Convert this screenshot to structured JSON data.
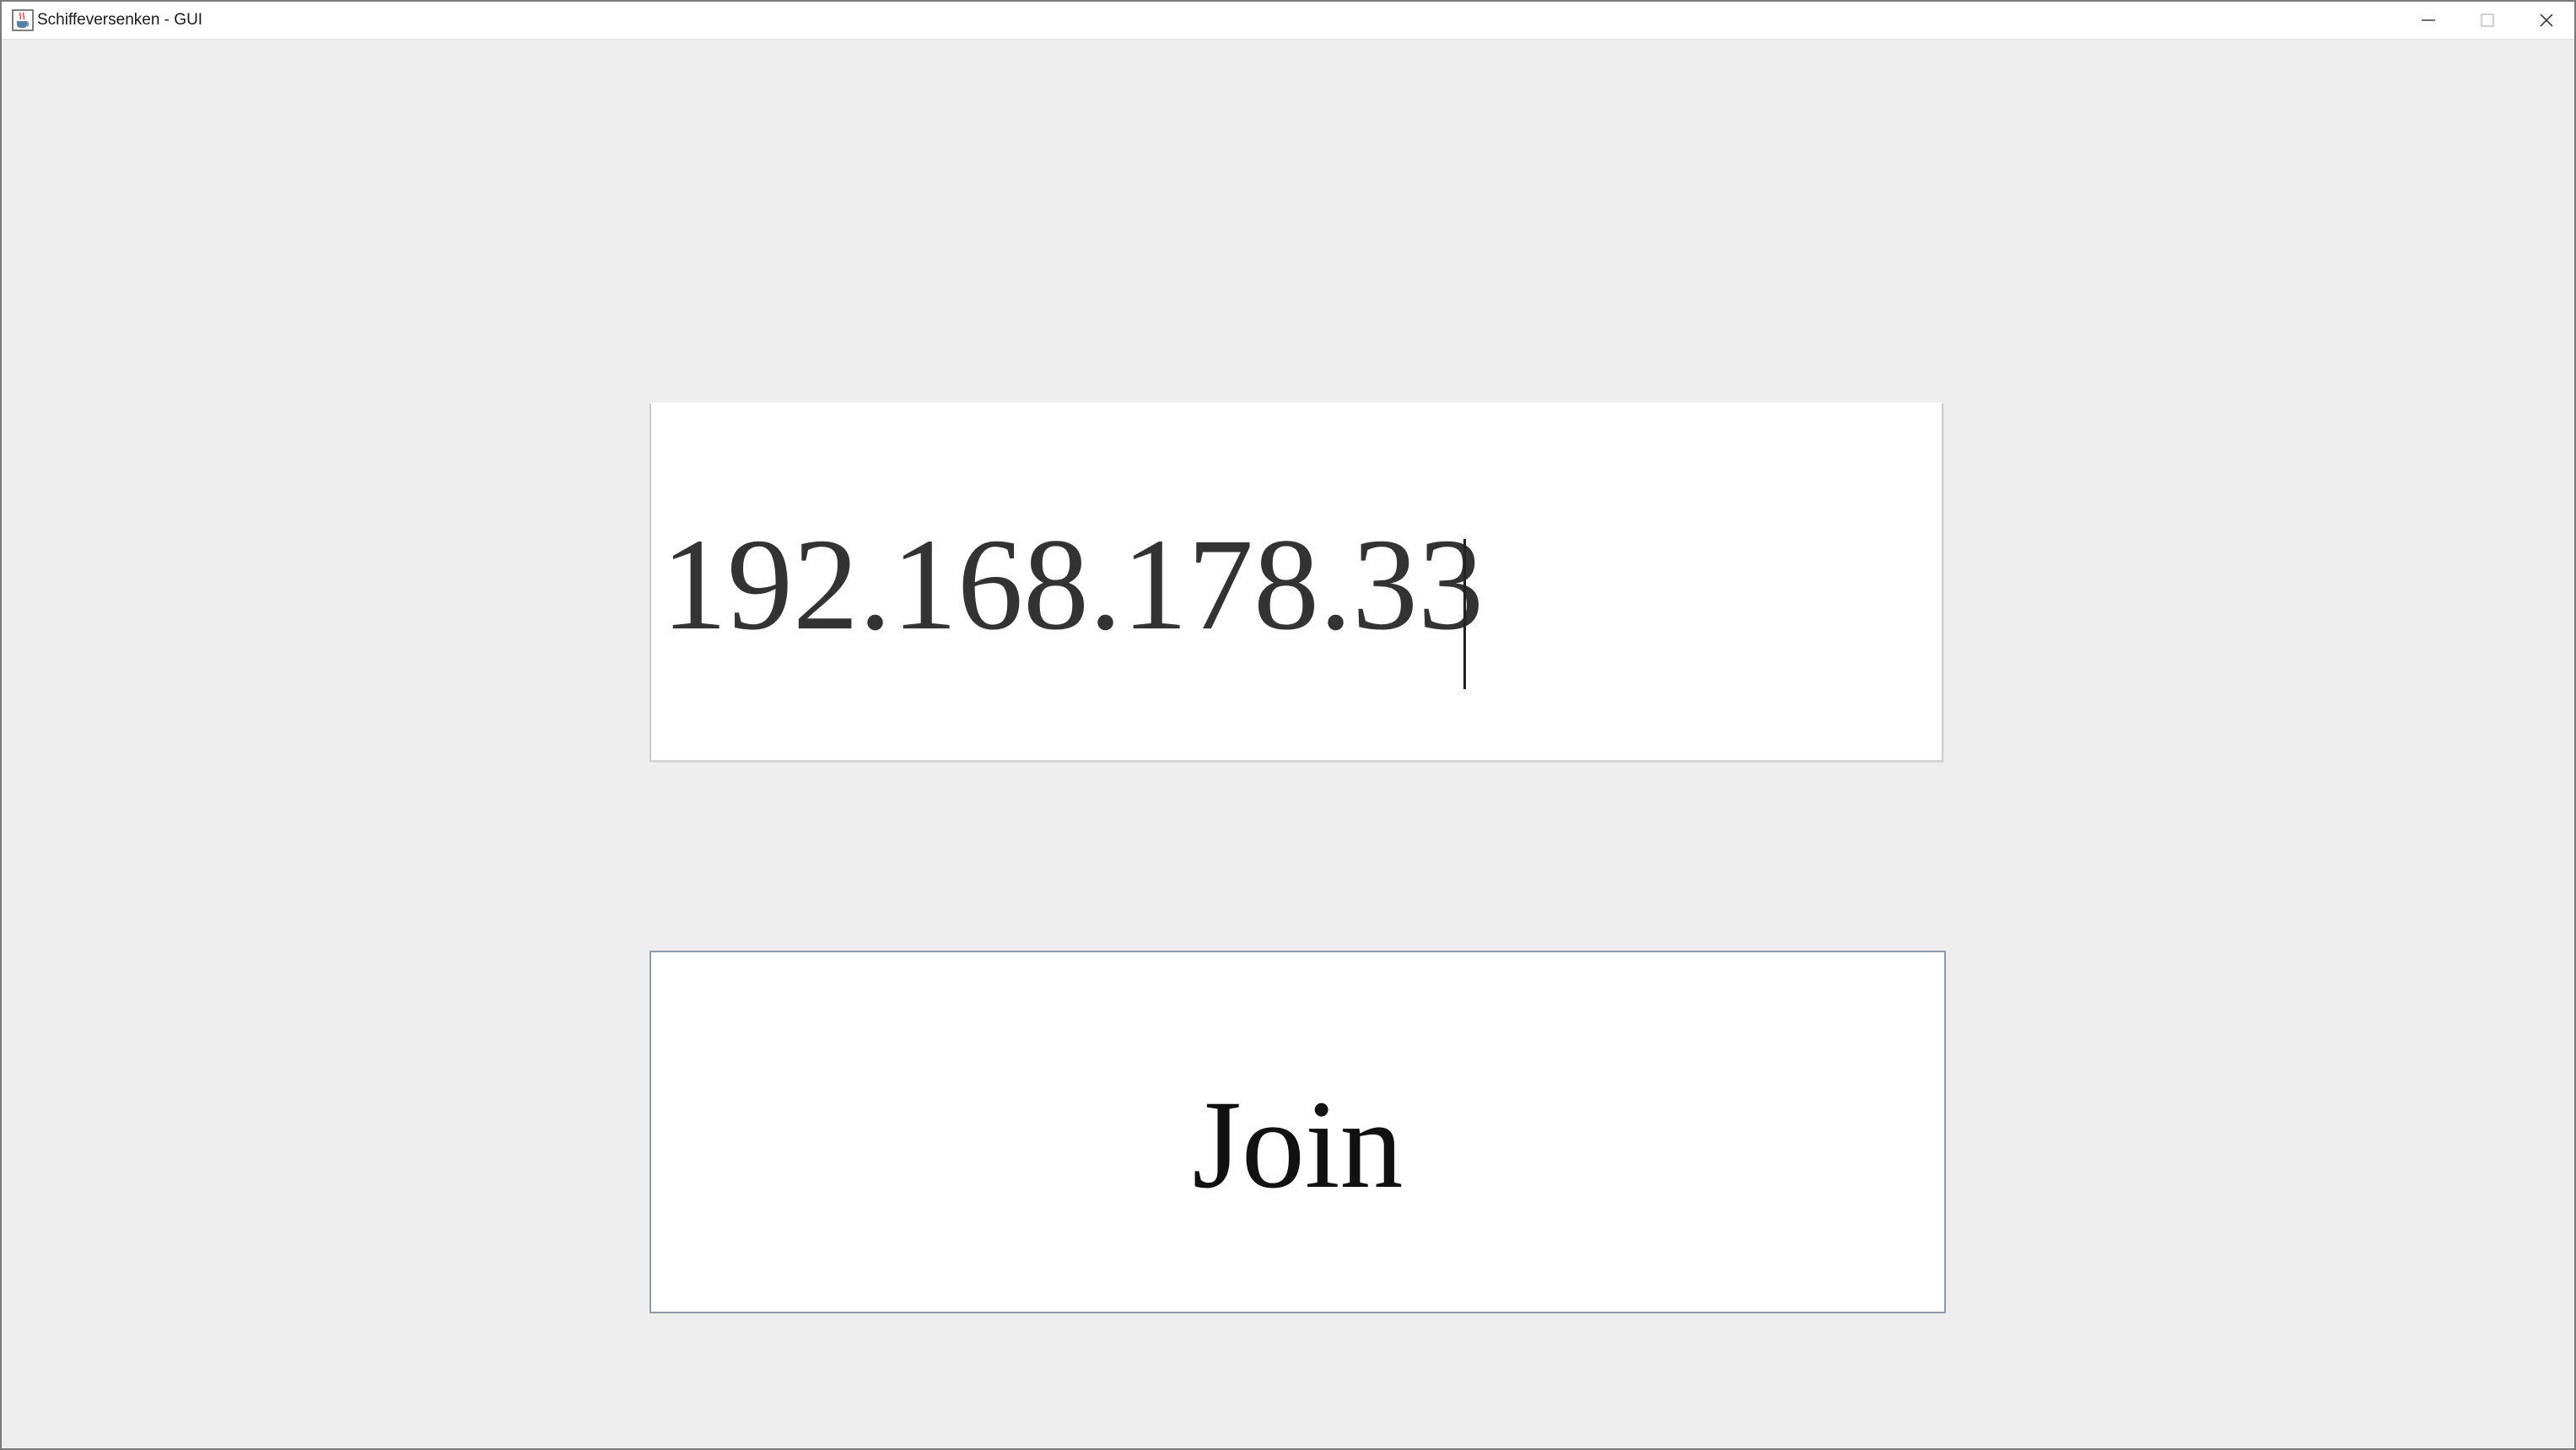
{
  "window": {
    "title": "Schiffeversenken - GUI",
    "app_icon": "java-cup-icon",
    "controls": {
      "minimize_icon": "minimize-icon",
      "maximize_icon": "maximize-icon",
      "close_icon": "close-icon"
    }
  },
  "connect_form": {
    "ip_input": {
      "value": "192.168.178.33",
      "has_focus": true
    },
    "join_button": {
      "label": "Join"
    }
  },
  "colors": {
    "background": "#eeeeee",
    "field_background": "#ffffff",
    "text": "#333333",
    "button_border": "#8f9aa8"
  }
}
